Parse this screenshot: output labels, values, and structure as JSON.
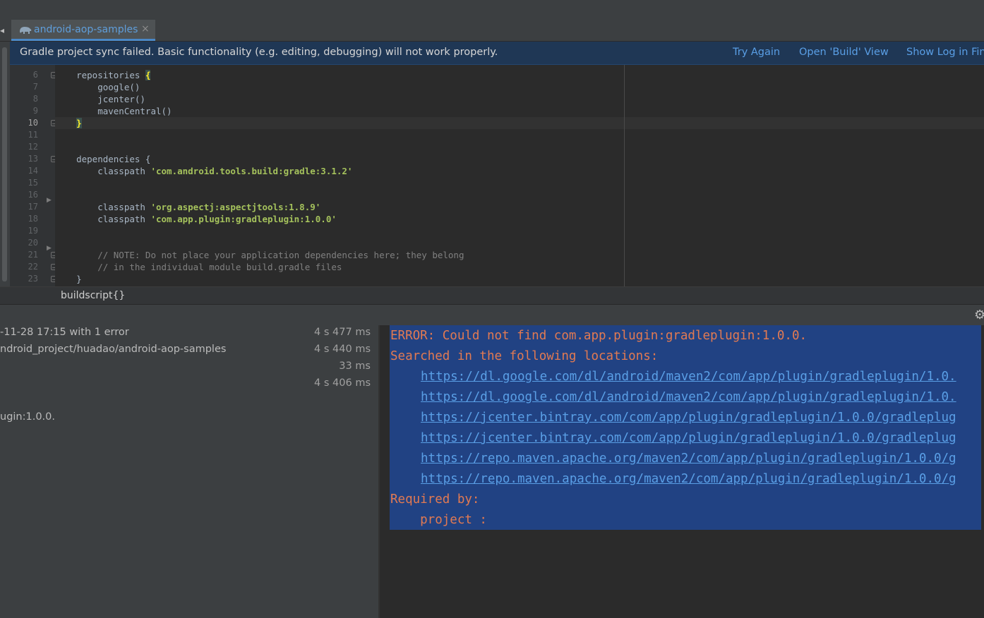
{
  "tab": {
    "label": "android-aop-samples",
    "close": "×"
  },
  "banner": {
    "message": "Gradle project sync failed. Basic functionality (e.g. editing, debugging) will not work properly.",
    "try_again": "Try Again",
    "open_build": "Open 'Build' View",
    "show_log": "Show Log in Finder"
  },
  "editor": {
    "line_numbers": [
      "6",
      "7",
      "8",
      "9",
      "10",
      "11",
      "12",
      "13",
      "14",
      "15",
      "16",
      "17",
      "18",
      "19",
      "20",
      "21",
      "22",
      "23"
    ],
    "current_line": "10",
    "code": {
      "l6a": "    repositories ",
      "l6b": "{",
      "l7": "        google()",
      "l8": "        jcenter()",
      "l9": "        mavenCentral()",
      "l10a": "    ",
      "l10b": "}",
      "l13": "    dependencies {",
      "l14a": "        classpath ",
      "l14b": "'com.android.tools.build:gradle:3.1.2'",
      "l17a": "        classpath ",
      "l17b": "'org.aspectj:aspectjtools:1.8.9'",
      "l18a": "        classpath ",
      "l18b": "'com.app.plugin:gradleplugin:1.0.0'",
      "l21": "        // NOTE: Do not place your application dependencies here; they belong",
      "l22": "        // in the individual module build.gradle files",
      "l23": "    }"
    }
  },
  "breadcrumb": "buildscript{}",
  "build_tree": {
    "rows": [
      {
        "text": "-11-28 17:15  with 1 error",
        "duration": "4 s 477 ms"
      },
      {
        "text": "ndroid_project/huadao/android-aop-samples",
        "duration": "4 s 440 ms"
      },
      {
        "text": "",
        "duration": "33 ms"
      },
      {
        "text": "",
        "duration": "4 s 406 ms"
      },
      {
        "text": "",
        "duration": ""
      },
      {
        "text": "ugin:1.0.0.",
        "duration": ""
      }
    ]
  },
  "console": {
    "error": "ERROR: Could not find com.app.plugin:gradleplugin:1.0.0.",
    "searched": "Searched in the following locations:",
    "links": [
      "https://dl.google.com/dl/android/maven2/com/app/plugin/gradleplugin/1.0.",
      "https://dl.google.com/dl/android/maven2/com/app/plugin/gradleplugin/1.0.",
      "https://jcenter.bintray.com/com/app/plugin/gradleplugin/1.0.0/gradleplug",
      "https://jcenter.bintray.com/com/app/plugin/gradleplugin/1.0.0/gradleplug",
      "https://repo.maven.apache.org/maven2/com/app/plugin/gradleplugin/1.0.0/g",
      "https://repo.maven.apache.org/maven2/com/app/plugin/gradleplugin/1.0.0/g"
    ],
    "required_by": "Required by:",
    "project": "    project :"
  },
  "colors": {
    "accent_link": "#5a9fe6",
    "error_text": "#e27a52",
    "selection": "#214283",
    "banner_bg": "#1f3755"
  },
  "icons": {
    "tab": "gradle-elephant-icon",
    "settings": "gear-icon"
  }
}
